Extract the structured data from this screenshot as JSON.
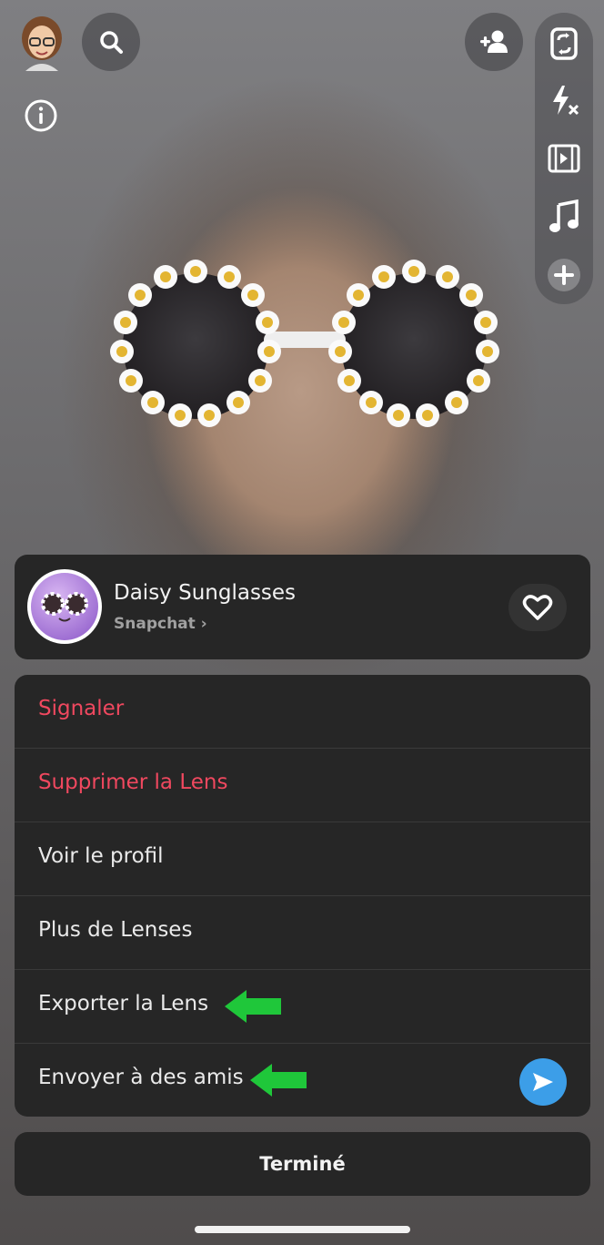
{
  "lens": {
    "name": "Daisy Sunglasses",
    "creator": "Snapchat ›"
  },
  "menu": {
    "items": [
      {
        "label": "Signaler"
      },
      {
        "label": "Supprimer la Lens"
      },
      {
        "label": "Voir le profil"
      },
      {
        "label": "Plus de Lenses"
      },
      {
        "label": "Exporter la Lens"
      },
      {
        "label": "Envoyer à des amis"
      }
    ]
  },
  "done": {
    "label": "Terminé"
  },
  "colors": {
    "danger": "#f0485f",
    "send_button": "#3c9ee8",
    "annotation_arrow": "#1fc73a",
    "panel_bg": "#262626"
  },
  "icons": {
    "top_left": [
      "bitmoji-avatar",
      "search-icon",
      "info-icon"
    ],
    "top_right": [
      "add-friend-icon",
      "flip-camera-icon",
      "flash-off-icon",
      "video-reel-icon",
      "music-note-icon",
      "plus-icon"
    ]
  }
}
